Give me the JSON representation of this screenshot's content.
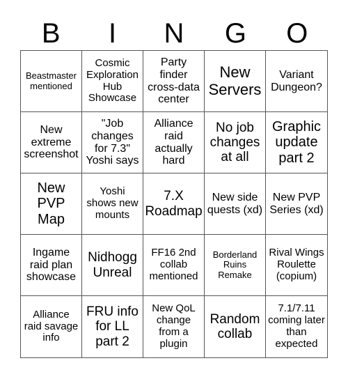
{
  "header": {
    "letters": [
      "B",
      "I",
      "N",
      "G",
      "O"
    ]
  },
  "cells": [
    "Beastmaster mentioned",
    "Cosmic Exploration Hub Showcase",
    "Party finder cross-data center",
    "New Servers",
    "Variant Dungeon?",
    "New extreme screenshot",
    "\"Job changes for 7.3\" Yoshi says",
    "Alliance raid actually hard",
    "No job changes at all",
    "Graphic update part 2",
    "New PVP Map",
    "Yoshi shows new mounts",
    "7.X Roadmap",
    "New side quests (xd)",
    "New PVP Series (xd)",
    "Ingame raid plan showcase",
    "Nidhogg Unreal",
    "FF16 2nd collab mentioned",
    "Borderland Ruins Remake",
    "Rival Wings Roulette (copium)",
    "Alliance raid savage info",
    "FRU info for LL part 2",
    "New QoL change from a plugin",
    "Random collab",
    "7.1/7.11 coming later than expected"
  ]
}
